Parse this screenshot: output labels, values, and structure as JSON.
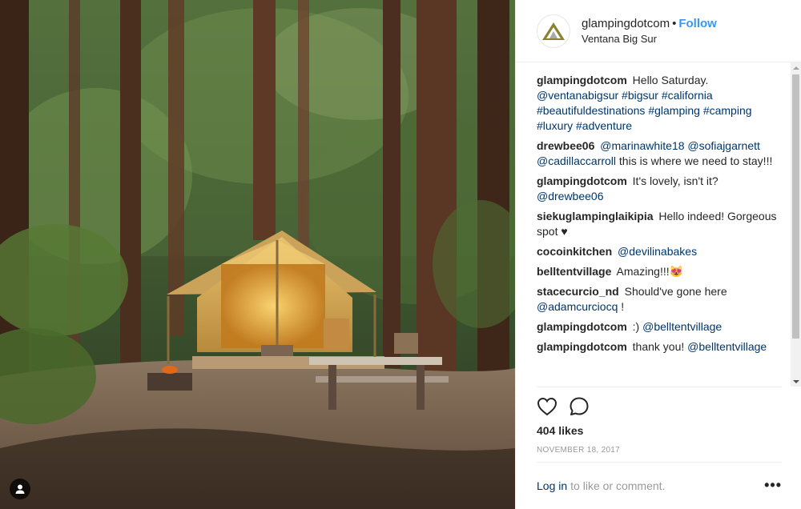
{
  "header": {
    "username": "glampingdotcom",
    "separator": "•",
    "follow_label": "Follow",
    "location": "Ventana Big Sur"
  },
  "caption": {
    "author": "glampingdotcom",
    "text": "Hello Saturday. ",
    "hashtags": "@ventanabigsur #bigsur #california #beautifuldestinations #glamping #camping #luxury #adventure"
  },
  "comments": [
    {
      "author": "drewbee06",
      "tags": "@marinawhite18 @sofiajgarnett @cadillaccarroll",
      "text": " this is where we need to stay!!!"
    },
    {
      "author": "glampingdotcom",
      "text": "It's lovely, isn't it? ",
      "tags": "@drewbee06"
    },
    {
      "author": "siekuglampinglaikipia",
      "text": "Hello indeed! Gorgeous spot ♥"
    },
    {
      "author": "cocoinkitchen",
      "tags": "@devilinabakes"
    },
    {
      "author": "belltentvillage",
      "text": "Amazing!!!😻"
    },
    {
      "author": "stacecurcio_nd",
      "text": "Should've gone here ",
      "tags": "@adamcurciocq",
      "suffix": " !"
    },
    {
      "author": "glampingdotcom",
      "text": ":) ",
      "tags": "@belltentvillage"
    },
    {
      "author": "glampingdotcom",
      "text": "thank you! ",
      "tags": "@belltentvillage"
    }
  ],
  "likes": "404 likes",
  "date": "NOVEMBER 18, 2017",
  "footer": {
    "login_label": "Log in",
    "login_rest": "to like or comment.",
    "more_label": "•••"
  },
  "icons": {
    "like": "heart-icon",
    "comment": "comment-bubble-icon",
    "avatar": "glamping-tent-logo-icon",
    "tag_user": "user-tag-icon"
  },
  "colors": {
    "follow": "#3897f0",
    "hashtag": "#003569",
    "muted": "#999999",
    "text": "#262626",
    "logo_olive": "#8b8132"
  }
}
